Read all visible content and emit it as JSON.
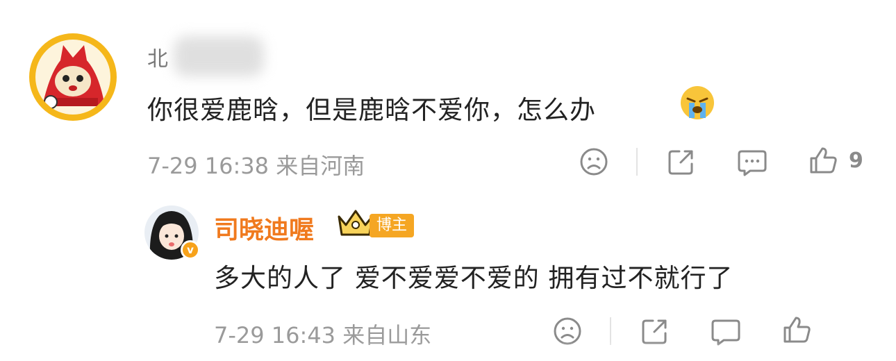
{
  "comments": [
    {
      "username": "北",
      "content": "你很爱鹿晗，但是鹿晗不爱你，怎么办",
      "emoji": "crying-face-emoji",
      "time": "7-29 16:38",
      "location": "来自河南",
      "like_count": "9",
      "replies": [
        {
          "username": "司晓迪喔",
          "badge": "博主",
          "verified_mark": "v",
          "content": "多大的人了 爱不爱爱不爱的 拥有过不就行了",
          "time": "7-29 16:43",
          "location": "来自山东"
        }
      ]
    }
  ],
  "colors": {
    "name_orange": "#f07a1e",
    "badge_orange": "#f5a623",
    "meta_gray": "#9a9a9a",
    "text_dark": "#222222"
  }
}
